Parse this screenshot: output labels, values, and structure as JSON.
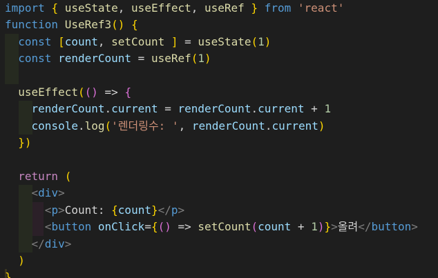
{
  "editor": {
    "theme": "dark",
    "colors": {
      "background": "#1e1e1e",
      "keyword": "#569cd6",
      "control": "#c586c0",
      "variable": "#9cdcfe",
      "function": "#dcdcaa",
      "string": "#ce9178",
      "number": "#b5cea8",
      "bracket_level1": "#ffd700",
      "bracket_level2": "#da70d6",
      "bracket_level3": "#179fff"
    },
    "code_lines": [
      "import { useState, useEffect, useRef } from 'react'",
      "function UseRef3() {",
      "  const [count, setCount ] = useState(1)",
      "  const renderCount = useRef(1)",
      "",
      "  useEffect(() => {",
      "    renderCount.current = renderCount.current + 1",
      "    console.log('렌더링수: ', renderCount.current)",
      "  })",
      "",
      "  return (",
      "    <div>",
      "      <p>Count: {count}</p>",
      "      <button onClick={() => setCount(count + 1)}>올려</button>",
      "    </div>",
      "  )",
      "}"
    ]
  }
}
